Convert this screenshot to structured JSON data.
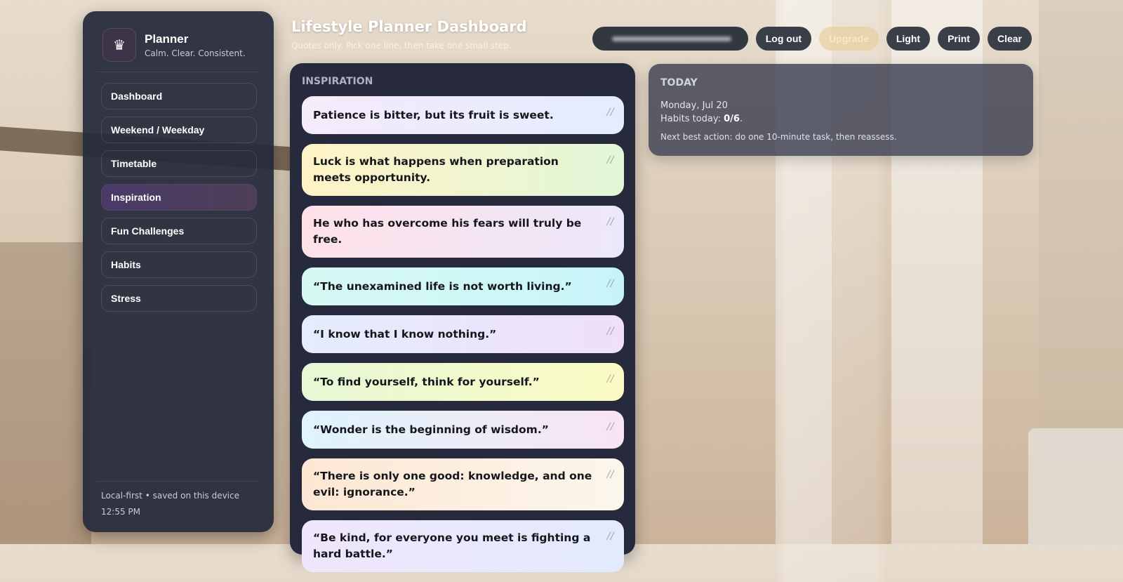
{
  "brand": {
    "title": "Planner",
    "subtitle": "Calm. Clear. Consistent.",
    "logo_icon": "crown-icon"
  },
  "nav": {
    "items": [
      {
        "label": "Dashboard",
        "active": false
      },
      {
        "label": "Weekend / Weekday",
        "active": false
      },
      {
        "label": "Timetable",
        "active": false
      },
      {
        "label": "Inspiration",
        "active": true
      },
      {
        "label": "Fun Challenges",
        "active": false
      },
      {
        "label": "Habits",
        "active": false
      },
      {
        "label": "Stress",
        "active": false
      }
    ]
  },
  "sidebar_footer": {
    "storage_note": "Local-first • saved on this device",
    "time": "12:55 PM"
  },
  "header": {
    "title": "Lifestyle Planner Dashboard",
    "subtitle": "Quotes only. Pick one line, then take one small step."
  },
  "toolbar": {
    "logout_label": "Log out",
    "upgrade_label": "Upgrade",
    "theme_label": "Light",
    "print_label": "Print",
    "clear_label": "Clear"
  },
  "inspiration": {
    "section_label": "INSPIRATION",
    "quote_mark": "//",
    "quotes": [
      "Patience is bitter, but its fruit is sweet.",
      "Luck is what happens when preparation meets opportunity.",
      "He who has overcome his fears will truly be free.",
      "“The unexamined life is not worth living.”",
      "“I know that I know nothing.”",
      "“To find yourself, think for yourself.”",
      "“Wonder is the beginning of wisdom.”",
      "“There is only one good: knowledge, and one evil: ignorance.”",
      "“Be kind, for everyone you meet is fighting a hard battle.”"
    ]
  },
  "today": {
    "section_label": "TODAY",
    "date": "Monday, Jul 20",
    "habits_prefix": "Habits today: ",
    "habits_value": "0/6",
    "habits_suffix": ".",
    "next_action": "Next best action: do one 10-minute task, then reassess."
  },
  "colors": {
    "sidebar_bg": "#262a3a",
    "active_nav": "#4a3a68",
    "upgrade_accent": "#e6c88c"
  }
}
